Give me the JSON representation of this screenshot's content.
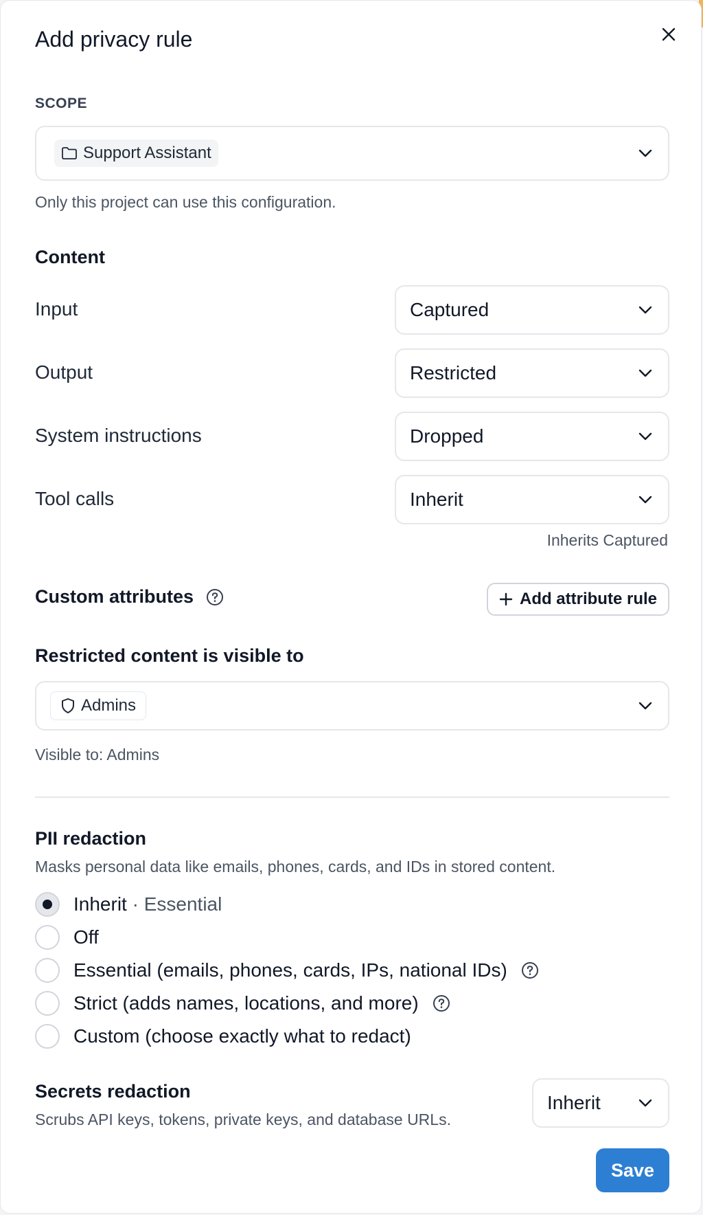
{
  "dialog": {
    "title": "Add privacy rule"
  },
  "scope": {
    "label": "SCOPE",
    "selected": "Support Assistant",
    "helper": "Only this project can use this configuration."
  },
  "content": {
    "heading": "Content",
    "rows": [
      {
        "label": "Input",
        "value": "Captured"
      },
      {
        "label": "Output",
        "value": "Restricted"
      },
      {
        "label": "System instructions",
        "value": "Dropped"
      },
      {
        "label": "Tool calls",
        "value": "Inherit"
      }
    ],
    "tool_calls_note": "Inherits Captured"
  },
  "custom_attributes": {
    "heading": "Custom attributes",
    "add_button": "Add attribute rule"
  },
  "visibility": {
    "heading": "Restricted content is visible to",
    "selected": "Admins",
    "helper": "Visible to: Admins"
  },
  "pii": {
    "heading": "PII redaction",
    "description": "Masks personal data like emails, phones, cards, and IDs in stored content.",
    "options": [
      {
        "label": "Inherit",
        "suffix": "· Essential",
        "checked": true
      },
      {
        "label": "Off"
      },
      {
        "label": "Essential (emails, phones, cards, IPs, national IDs)"
      },
      {
        "label": "Strict (adds names, locations, and more)"
      },
      {
        "label": "Custom (choose exactly what to redact)"
      }
    ]
  },
  "secrets": {
    "heading": "Secrets redaction",
    "description": "Scrubs API keys, tokens, private keys, and database URLs.",
    "value": "Inherit"
  },
  "footer": {
    "save_label": "Save"
  },
  "colors": {
    "primary": "#2d7fd3",
    "border": "#e5e7eb",
    "text": "#111827"
  }
}
